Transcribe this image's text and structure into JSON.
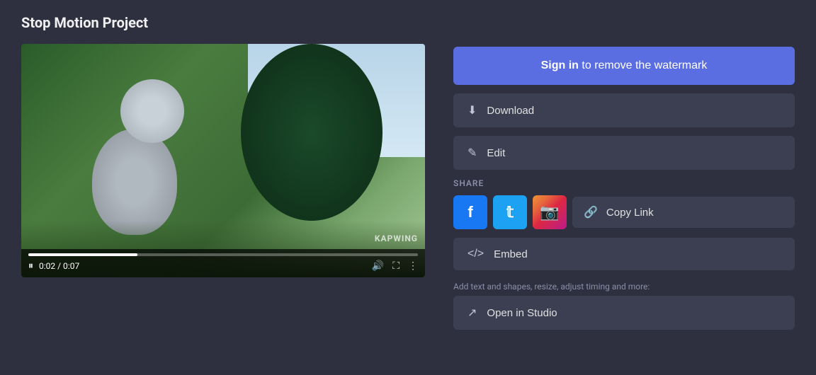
{
  "page": {
    "title": "Stop Motion Project"
  },
  "video": {
    "current_time": "0:02",
    "duration": "0:07",
    "progress_percent": 28,
    "watermark": "KAPWING"
  },
  "controls": {
    "pause_icon": "⏸",
    "volume_icon": "🔊",
    "fullscreen_icon": "⛶",
    "more_icon": "⋮"
  },
  "sign_in_btn": {
    "label_bold": "Sign in",
    "label_rest": " to remove the watermark"
  },
  "buttons": {
    "download": "Download",
    "edit": "Edit",
    "copy_link": "Copy Link",
    "embed": "Embed",
    "open_studio": "Open in Studio"
  },
  "share": {
    "label": "SHARE",
    "facebook_icon": "f",
    "twitter_icon": "t",
    "instagram_icon": "in"
  },
  "helper_text": "Add text and shapes, resize, adjust timing and more:"
}
